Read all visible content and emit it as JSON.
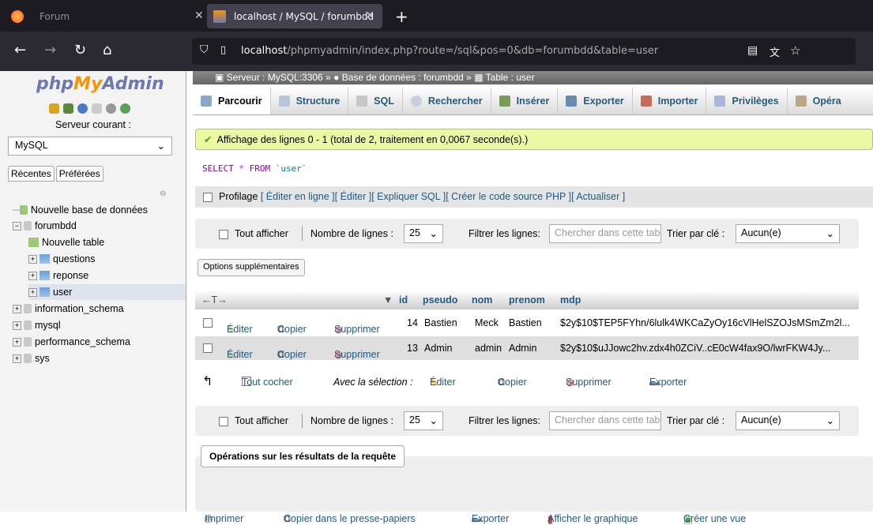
{
  "browser": {
    "tab_inactive": "Forum",
    "tab_active": "localhost / MySQL / forumbdd",
    "url_host": "localhost",
    "url_path": "/phpmyadmin/index.php?route=/sql&pos=0&db=forumbdd&table=user"
  },
  "sidebar": {
    "logo_php": "php",
    "logo_my": "My",
    "logo_admin": "Admin",
    "server_label": "Serveur courant :",
    "server_value": "MySQL",
    "tab_recent": "Récentes",
    "tab_fav": "Préférées",
    "tree": [
      "Nouvelle base de données",
      "forumbdd",
      "Nouvelle table",
      "questions",
      "reponse",
      "user",
      "information_schema",
      "mysql",
      "performance_schema",
      "sys"
    ]
  },
  "breadcrumb": {
    "server": "Serveur : MySQL:3306",
    "db": "Base de données : forumbdd",
    "table": "Table : user",
    "sep": "»"
  },
  "tabs": [
    "Parcourir",
    "Structure",
    "SQL",
    "Rechercher",
    "Insérer",
    "Exporter",
    "Importer",
    "Privilèges",
    "Opéra"
  ],
  "message": "Affichage des lignes 0 - 1 (total de 2, traitement en 0,0067 seconde(s).)",
  "sql": {
    "kw1": "SELECT",
    "star": "*",
    "kw2": "FROM",
    "table": "`user`"
  },
  "profil": {
    "label": "Profilage",
    "links": [
      "[ Éditer en ligne ]",
      "[ Éditer ]",
      "[ Expliquer SQL ]",
      "[ Créer le code source PHP ]",
      "[ Actualiser ]"
    ]
  },
  "nav": {
    "show_all": "Tout afficher",
    "rows_label": "Nombre de lignes :",
    "rows_value": "25",
    "filter_label": "Filtrer les lignes:",
    "filter_placeholder": "Chercher dans cette tab",
    "sort_label": "Trier par clé :",
    "sort_value": "Aucun(e)"
  },
  "options_btn": "Options supplémentaires",
  "table": {
    "arrows": "←T→",
    "columns": [
      "id",
      "pseudo",
      "nom",
      "prenom",
      "mdp"
    ],
    "actions": [
      "Éditer",
      "Copier",
      "Supprimer"
    ],
    "rows": [
      {
        "id": "14",
        "pseudo": "Bastien",
        "nom": "Meck",
        "prenom": "Bastien",
        "mdp": "$2y$10$TEP5FYhn/6lulk4WKCaZyOy16cVlHelSZOJsMSmZm2l..."
      },
      {
        "id": "13",
        "pseudo": "Admin",
        "nom": "admin",
        "prenom": "Admin",
        "mdp": "$2y$10$uJJowc2hv.zdx4h0ZCiV..cE0cW4fax9O/lwrFKW4Jy..."
      }
    ]
  },
  "bulk": {
    "check_all": "Tout cocher",
    "with_sel": "Avec la sélection :",
    "edit": "Éditer",
    "copy": "Copier",
    "delete": "Supprimer",
    "export": "Exporter"
  },
  "ops": {
    "title": "Opérations sur les résultats de la requête",
    "items": [
      "Imprimer",
      "Copier dans le presse-papiers",
      "Exporter",
      "Afficher le graphique",
      "Créer une vue"
    ]
  }
}
